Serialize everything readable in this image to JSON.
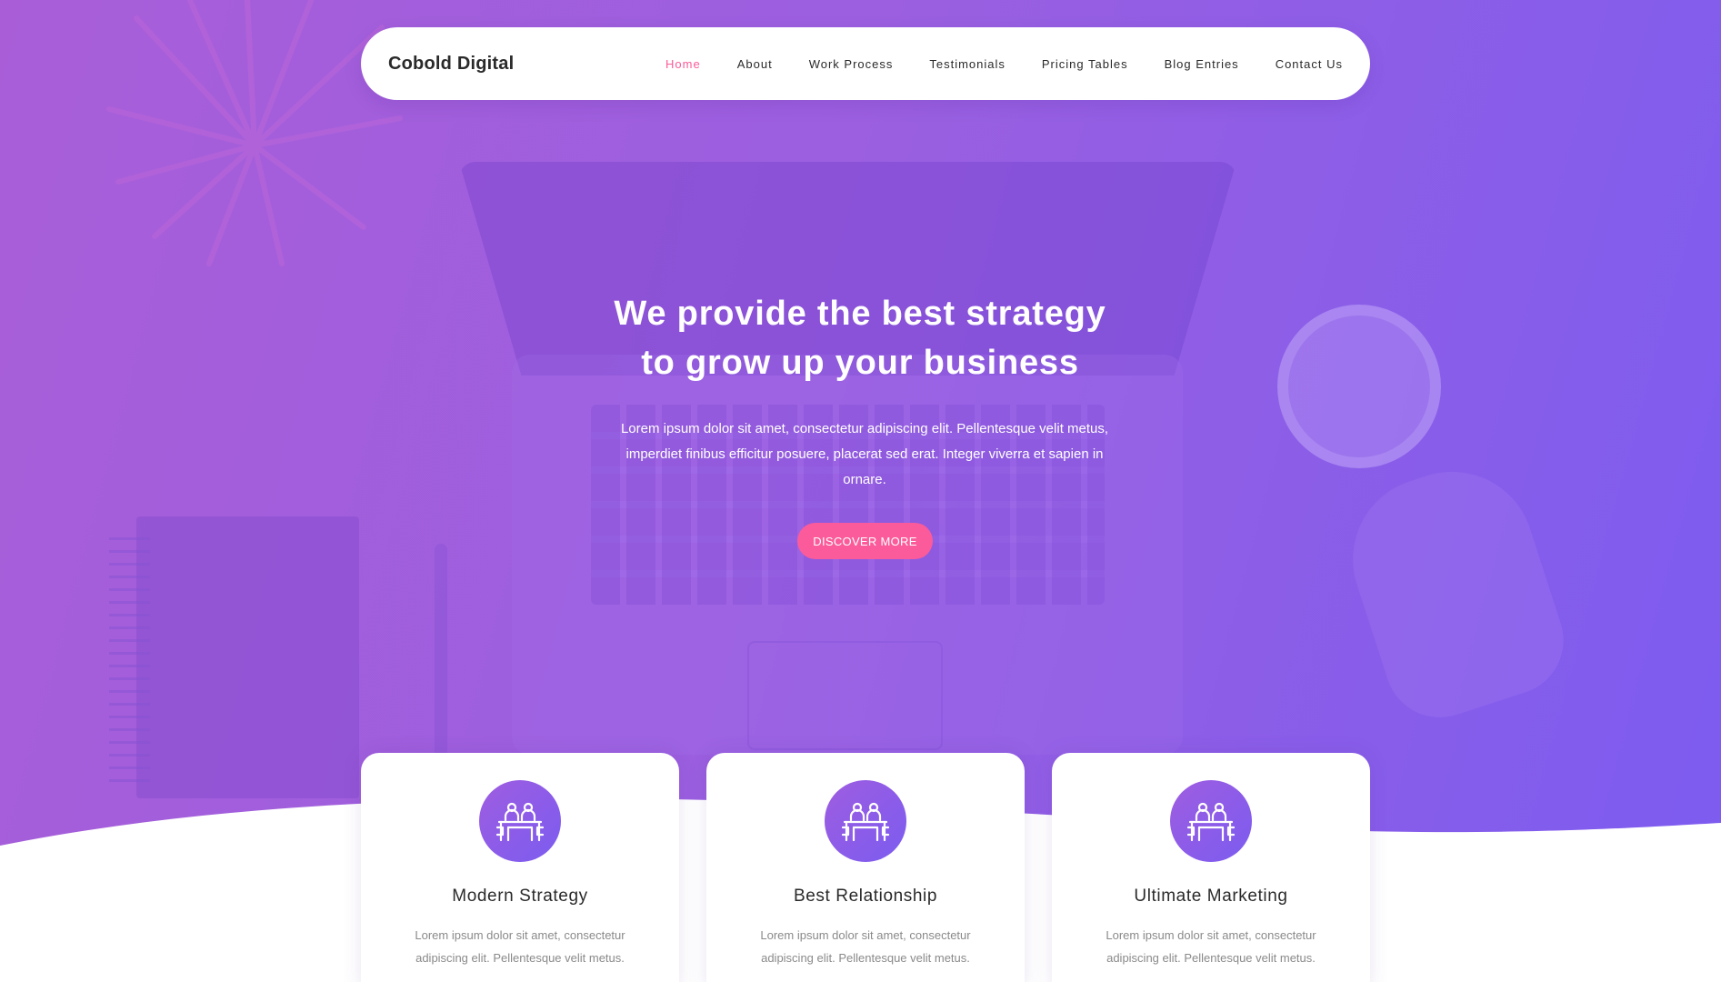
{
  "navbar": {
    "brand": "Cobold Digital",
    "links": [
      {
        "label": "Home",
        "active": true
      },
      {
        "label": "About",
        "active": false
      },
      {
        "label": "Work Process",
        "active": false
      },
      {
        "label": "Testimonials",
        "active": false
      },
      {
        "label": "Pricing Tables",
        "active": false
      },
      {
        "label": "Blog Entries",
        "active": false
      },
      {
        "label": "Contact Us",
        "active": false
      }
    ]
  },
  "hero": {
    "title_line1_pre": "We provide the best ",
    "title_line1_bold": "strategy",
    "title_line2_pre": "to grow up your ",
    "title_line2_bold": "business",
    "description": "Lorem ipsum dolor sit amet, consectetur adipiscing elit. Pellentesque velit metus, imperdiet finibus efficitur posuere, placerat sed erat. Integer viverra et sapien in ornare.",
    "cta_label": "DISCOVER MORE"
  },
  "services": [
    {
      "icon": "meeting-icon",
      "title": "Modern Strategy",
      "text": "Lorem ipsum dolor sit amet, consectetur adipiscing elit. Pellentesque velit metus."
    },
    {
      "icon": "meeting-icon",
      "title": "Best Relationship",
      "text": "Lorem ipsum dolor sit amet, consectetur adipiscing elit. Pellentesque velit metus."
    },
    {
      "icon": "meeting-icon",
      "title": "Ultimate Marketing",
      "text": "Lorem ipsum dolor sit amet, consectetur adipiscing elit. Pellentesque velit metus."
    }
  ],
  "colors": {
    "accent_pink": "#fb5b9a",
    "gradient_start": "#a95ed8",
    "gradient_end": "#7c5cf0",
    "text_dark": "#2a2a2a",
    "text_muted": "#8a8a8a"
  }
}
